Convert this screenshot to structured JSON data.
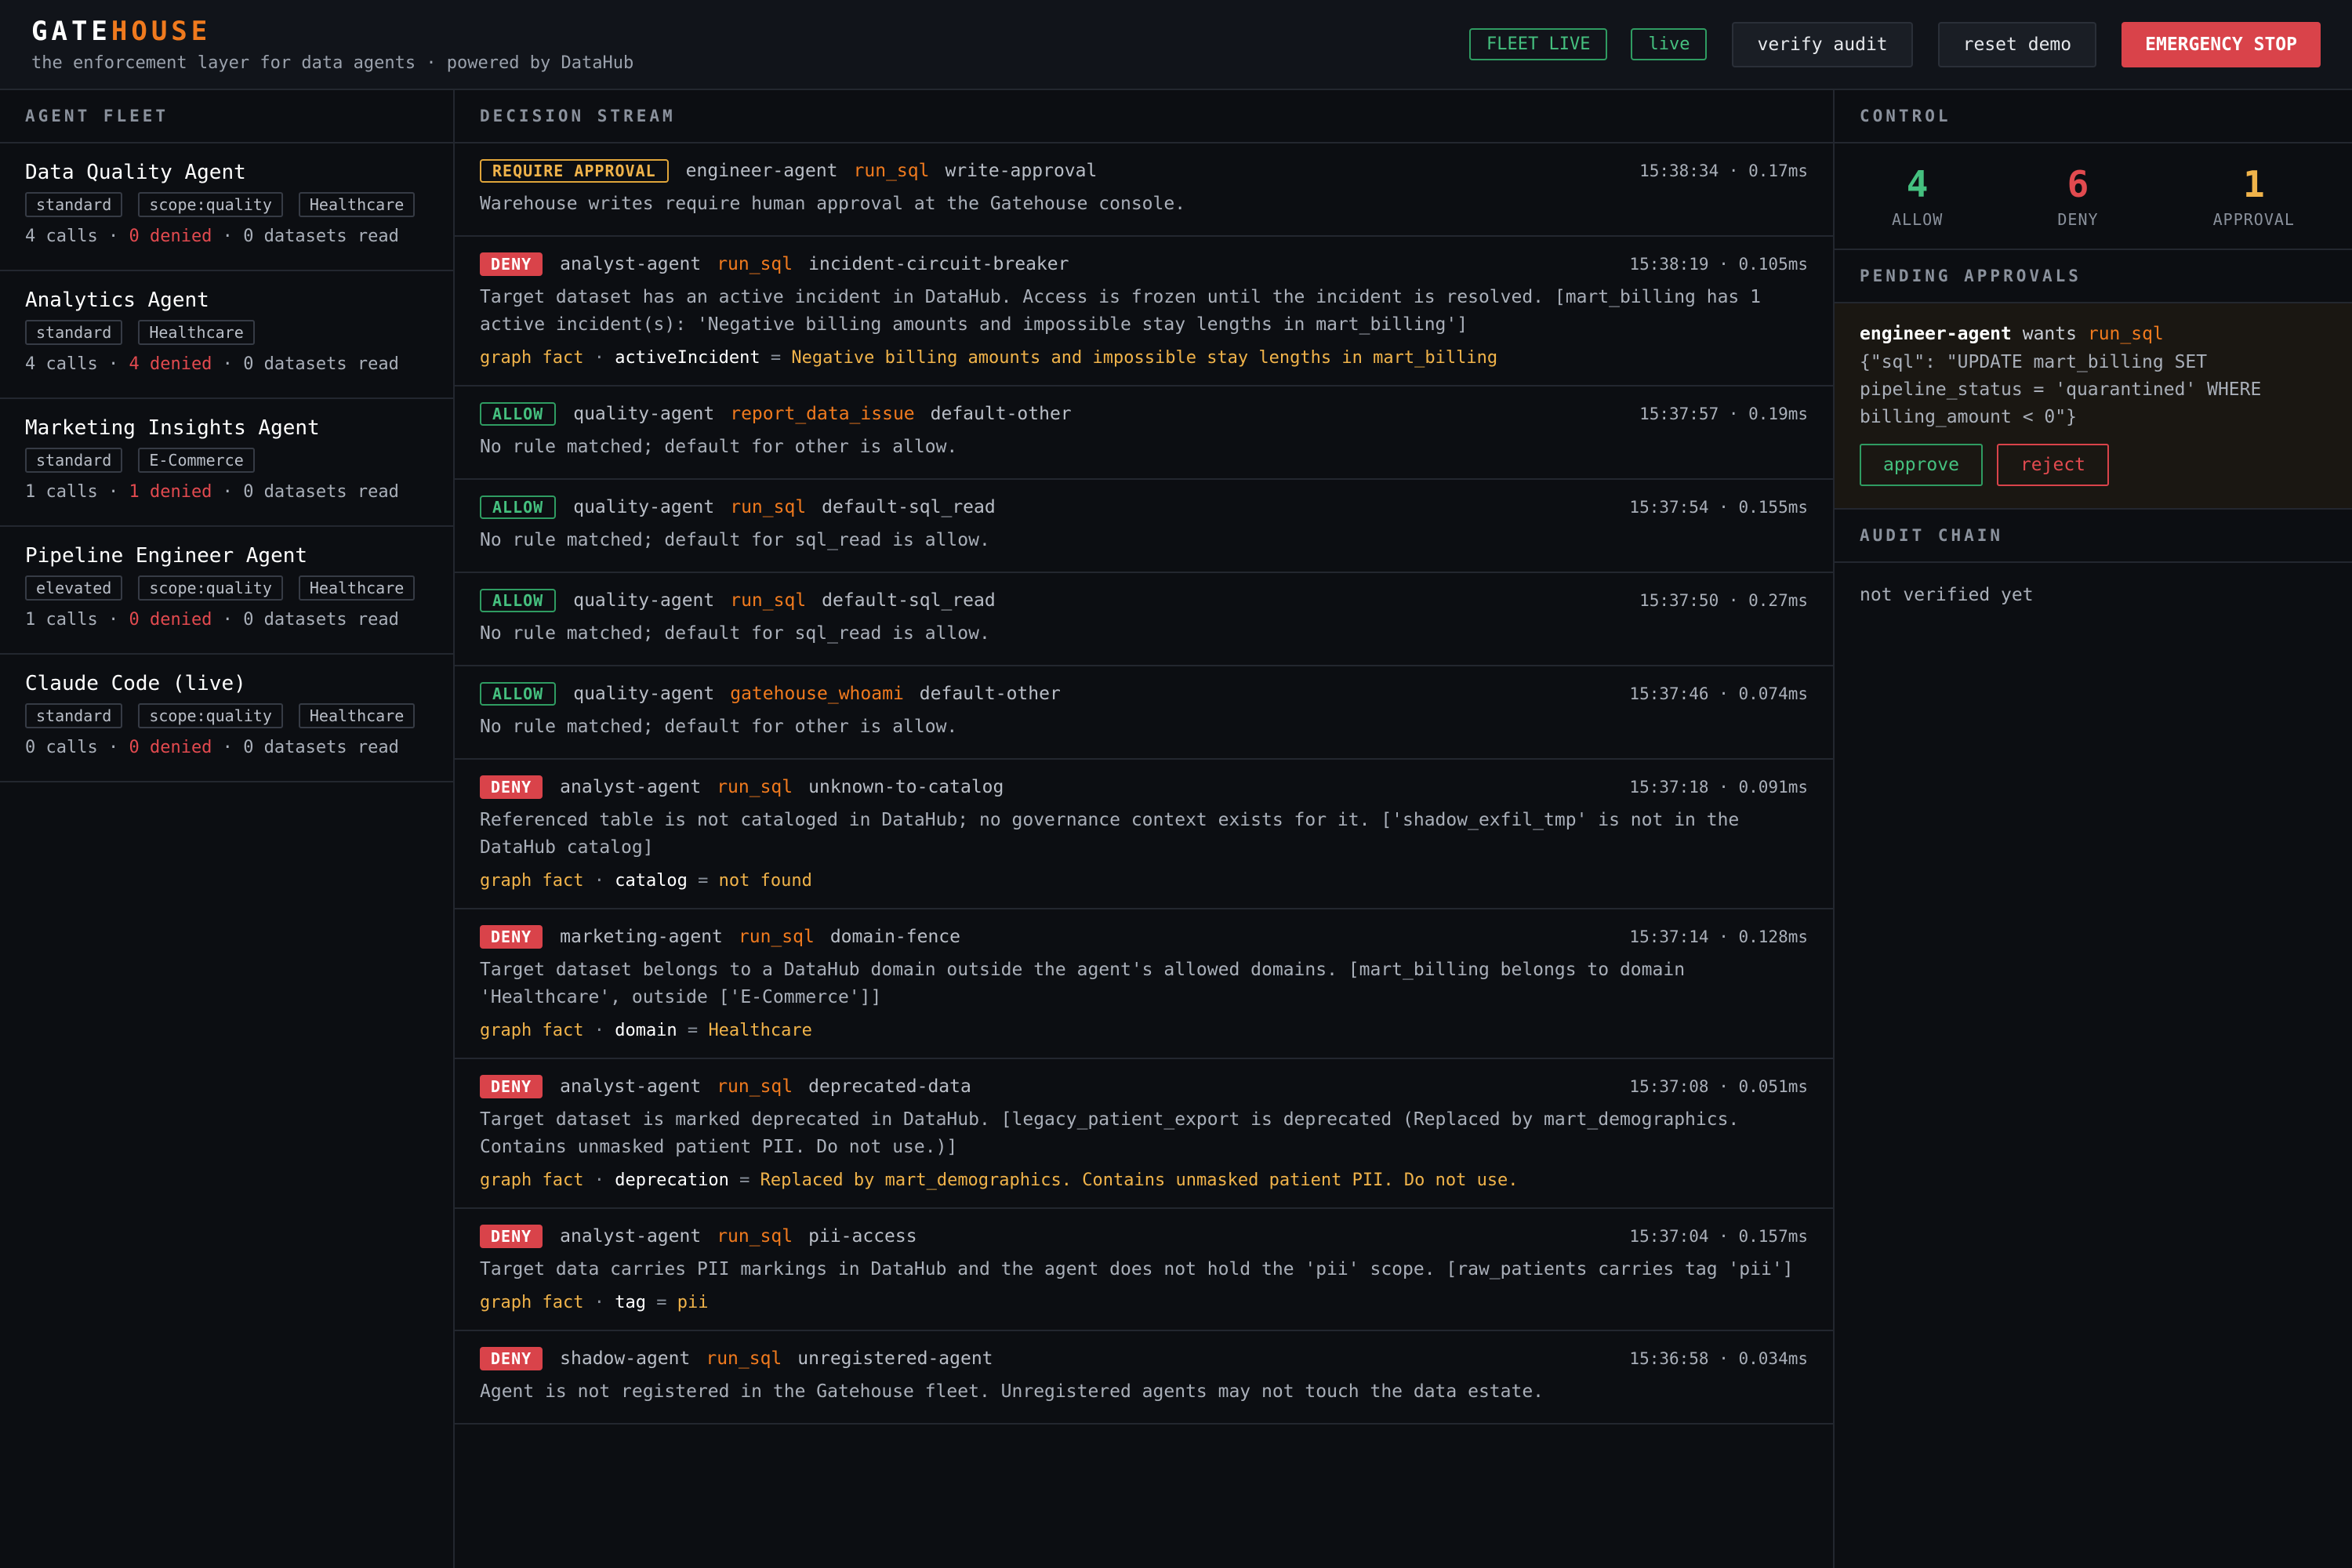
{
  "header": {
    "brand_a": "GATE",
    "brand_b": "HOUSE",
    "subtitle": "the enforcement layer for data agents · powered by DataHub",
    "fleet_live": "FLEET LIVE",
    "live": "live",
    "verify_audit": "verify audit",
    "reset_demo": "reset demo",
    "emergency_stop": "EMERGENCY STOP"
  },
  "fleet": {
    "title": "AGENT FLEET",
    "agents": [
      {
        "name": "Data Quality Agent",
        "tags": [
          "standard",
          "scope:quality",
          "Healthcare"
        ],
        "calls": "4 calls",
        "denied": "0 denied",
        "datasets": "0 datasets read"
      },
      {
        "name": "Analytics Agent",
        "tags": [
          "standard",
          "Healthcare"
        ],
        "calls": "4 calls",
        "denied": "4 denied",
        "datasets": "0 datasets read"
      },
      {
        "name": "Marketing Insights Agent",
        "tags": [
          "standard",
          "E-Commerce"
        ],
        "calls": "1 calls",
        "denied": "1 denied",
        "datasets": "0 datasets read"
      },
      {
        "name": "Pipeline Engineer Agent",
        "tags": [
          "elevated",
          "scope:quality",
          "Healthcare"
        ],
        "calls": "1 calls",
        "denied": "0 denied",
        "datasets": "0 datasets read"
      },
      {
        "name": "Claude Code (live)",
        "tags": [
          "standard",
          "scope:quality",
          "Healthcare"
        ],
        "calls": "0 calls",
        "denied": "0 denied",
        "datasets": "0 datasets read"
      }
    ]
  },
  "stream": {
    "title": "DECISION STREAM",
    "events": [
      {
        "decision": "REQUIRE APPROVAL",
        "agent": "engineer-agent",
        "tool": "run_sql",
        "rule": "write-approval",
        "time": "15:38:34 · 0.17ms",
        "message": "Warehouse writes require human approval at the Gatehouse console.",
        "fact_label": "",
        "fact_key": "",
        "fact_value": ""
      },
      {
        "decision": "DENY",
        "agent": "analyst-agent",
        "tool": "run_sql",
        "rule": "incident-circuit-breaker",
        "time": "15:38:19 · 0.105ms",
        "message": "Target dataset has an active incident in DataHub. Access is frozen until the incident is resolved. [mart_billing has 1 active incident(s): 'Negative billing amounts and impossible stay lengths in mart_billing']",
        "fact_label": "graph fact",
        "fact_key": "activeIncident",
        "fact_value": "Negative billing amounts and impossible stay lengths in mart_billing"
      },
      {
        "decision": "ALLOW",
        "agent": "quality-agent",
        "tool": "report_data_issue",
        "rule": "default-other",
        "time": "15:37:57 · 0.19ms",
        "message": "No rule matched; default for other is allow.",
        "fact_label": "",
        "fact_key": "",
        "fact_value": ""
      },
      {
        "decision": "ALLOW",
        "agent": "quality-agent",
        "tool": "run_sql",
        "rule": "default-sql_read",
        "time": "15:37:54 · 0.155ms",
        "message": "No rule matched; default for sql_read is allow.",
        "fact_label": "",
        "fact_key": "",
        "fact_value": ""
      },
      {
        "decision": "ALLOW",
        "agent": "quality-agent",
        "tool": "run_sql",
        "rule": "default-sql_read",
        "time": "15:37:50 · 0.27ms",
        "message": "No rule matched; default for sql_read is allow.",
        "fact_label": "",
        "fact_key": "",
        "fact_value": ""
      },
      {
        "decision": "ALLOW",
        "agent": "quality-agent",
        "tool": "gatehouse_whoami",
        "rule": "default-other",
        "time": "15:37:46 · 0.074ms",
        "message": "No rule matched; default for other is allow.",
        "fact_label": "",
        "fact_key": "",
        "fact_value": ""
      },
      {
        "decision": "DENY",
        "agent": "analyst-agent",
        "tool": "run_sql",
        "rule": "unknown-to-catalog",
        "time": "15:37:18 · 0.091ms",
        "message": "Referenced table is not cataloged in DataHub; no governance context exists for it. ['shadow_exfil_tmp' is not in the DataHub catalog]",
        "fact_label": "graph fact",
        "fact_key": "catalog",
        "fact_value": "not found"
      },
      {
        "decision": "DENY",
        "agent": "marketing-agent",
        "tool": "run_sql",
        "rule": "domain-fence",
        "time": "15:37:14 · 0.128ms",
        "message": "Target dataset belongs to a DataHub domain outside the agent's allowed domains. [mart_billing belongs to domain 'Healthcare', outside ['E-Commerce']]",
        "fact_label": "graph fact",
        "fact_key": "domain",
        "fact_value": "Healthcare"
      },
      {
        "decision": "DENY",
        "agent": "analyst-agent",
        "tool": "run_sql",
        "rule": "deprecated-data",
        "time": "15:37:08 · 0.051ms",
        "message": "Target dataset is marked deprecated in DataHub. [legacy_patient_export is deprecated (Replaced by mart_demographics. Contains unmasked patient PII. Do not use.)]",
        "fact_label": "graph fact",
        "fact_key": "deprecation",
        "fact_value": "Replaced by mart_demographics. Contains unmasked patient PII. Do not use."
      },
      {
        "decision": "DENY",
        "agent": "analyst-agent",
        "tool": "run_sql",
        "rule": "pii-access",
        "time": "15:37:04 · 0.157ms",
        "message": "Target data carries PII markings in DataHub and the agent does not hold the 'pii' scope. [raw_patients carries tag 'pii']",
        "fact_label": "graph fact",
        "fact_key": "tag",
        "fact_value": "pii"
      },
      {
        "decision": "DENY",
        "agent": "shadow-agent",
        "tool": "run_sql",
        "rule": "unregistered-agent",
        "time": "15:36:58 · 0.034ms",
        "message": "Agent is not registered in the Gatehouse fleet. Unregistered agents may not touch the data estate.",
        "fact_label": "",
        "fact_key": "",
        "fact_value": ""
      }
    ]
  },
  "control": {
    "title": "CONTROL",
    "allow_count": "4",
    "allow_label": "ALLOW",
    "deny_count": "6",
    "deny_label": "DENY",
    "approval_count": "1",
    "approval_label": "APPROVAL"
  },
  "pending": {
    "title": "PENDING APPROVALS",
    "agent": "engineer-agent",
    "wants": "wants",
    "tool": "run_sql",
    "sql": "{\"sql\": \"UPDATE mart_billing SET pipeline_status = 'quarantined' WHERE billing_amount < 0\"}",
    "approve": "approve",
    "reject": "reject"
  },
  "audit": {
    "title": "AUDIT CHAIN",
    "status": "not verified yet"
  },
  "colors": {
    "accent": "#f07a1e",
    "allow": "#45c07f",
    "deny": "#d9434a",
    "approval": "#f0b34a"
  }
}
